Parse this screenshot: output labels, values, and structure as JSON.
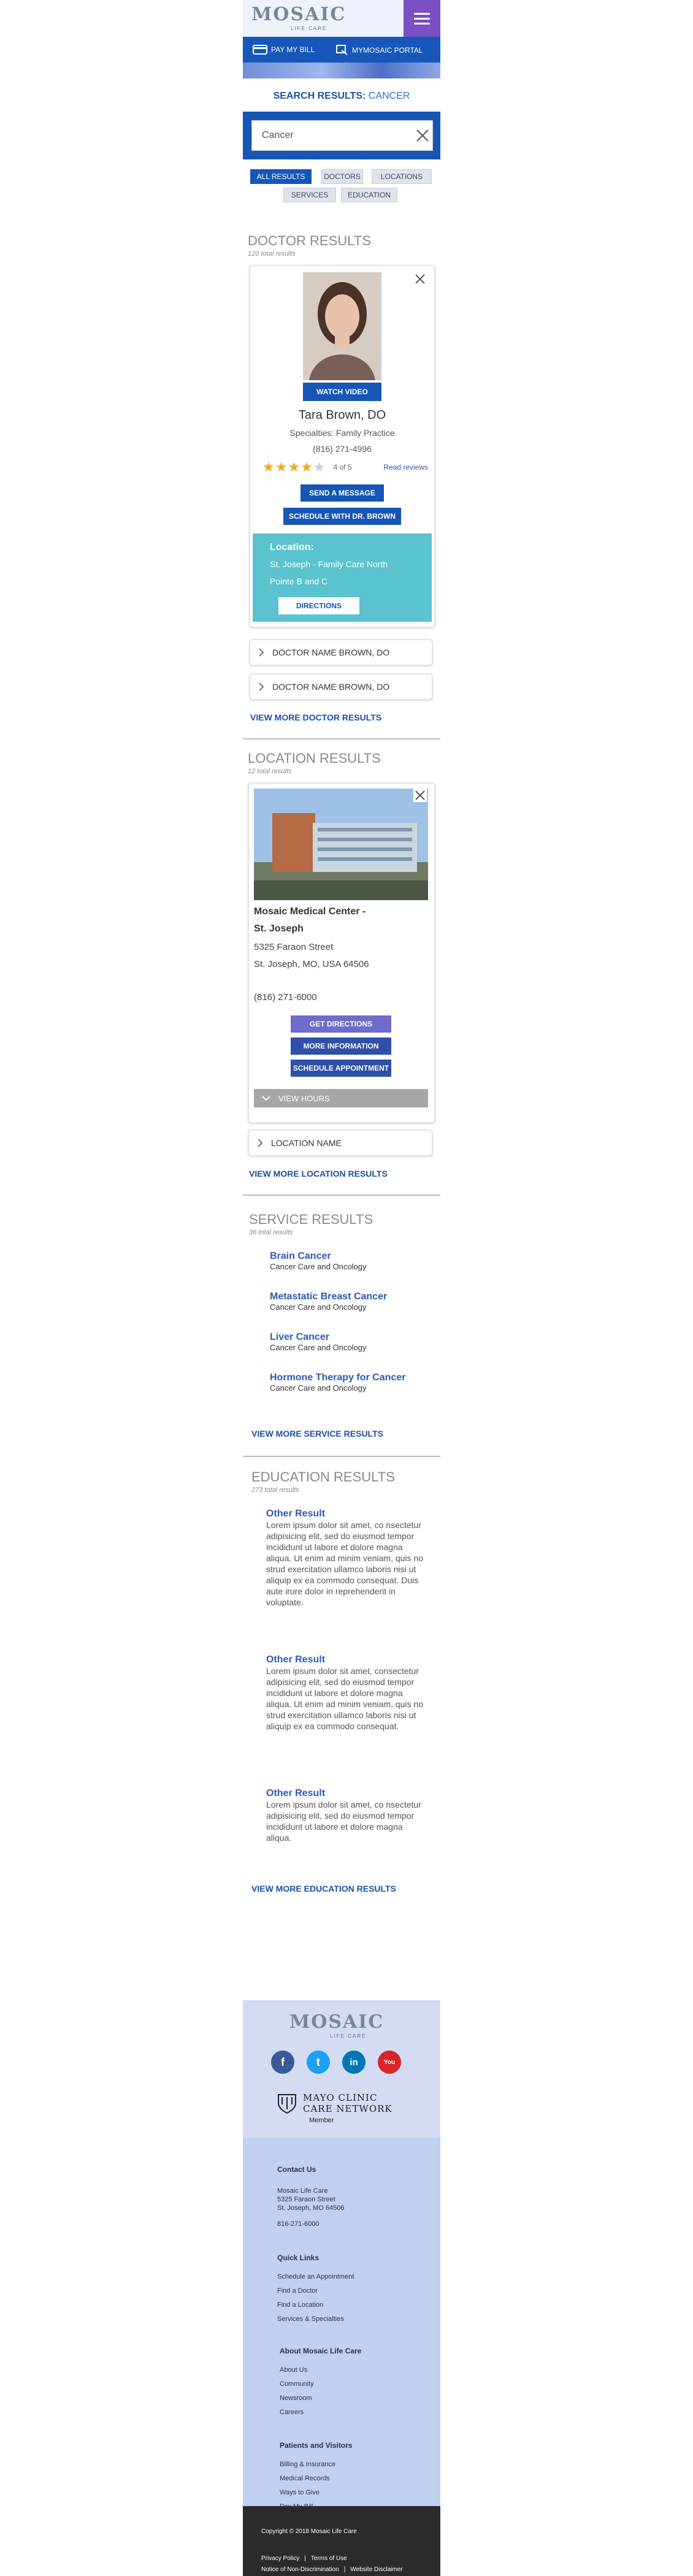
{
  "header": {
    "logo": "MOSAIC",
    "logo_sub": "LIFE CARE",
    "menu_icon": "hamburger-icon"
  },
  "topbar": {
    "pay_bill": "PAY MY BILL",
    "portal": "MYMOSAIC PORTAL"
  },
  "search": {
    "label": "SEARCH RESULTS:",
    "term": "CANCER",
    "value": "Cancer"
  },
  "filters": [
    "ALL RESULTS",
    "DOCTORS",
    "LOCATIONS",
    "SERVICES",
    "EDUCATION"
  ],
  "doctors": {
    "title": "DOCTOR RESULTS",
    "count": "120 total results",
    "featured": {
      "watch_video": "WATCH VIDEO",
      "name": "Tara Brown, DO",
      "specialty": "Specialties: Family Practice",
      "phone": "(816) 271-4996",
      "rating": "4 of 5",
      "rating_value": 4,
      "read_reviews": "Read reviews",
      "send_message": "SEND A MESSAGE",
      "schedule": "SCHEDULE WITH DR. BROWN",
      "location_label": "Location:",
      "location_line1": "St. Joseph - Family Care North",
      "location_line2": "Pointe B and C",
      "directions": "DIRECTIONS"
    },
    "collapsed": [
      "DOCTOR NAME BROWN, DO",
      "DOCTOR NAME BROWN, DO"
    ],
    "view_more": "VIEW MORE DOCTOR RESULTS"
  },
  "locations": {
    "title": "LOCATION RESULTS",
    "count": "12 total results",
    "featured": {
      "name_line1": "Mosaic Medical Center -",
      "name_line2": "St. Joseph",
      "address1": "5325 Faraon Street",
      "address2": "St. Joseph, MO, USA 64506",
      "phone": "(816) 271-6000",
      "get_directions": "GET DIRECTIONS",
      "more_info": "MORE INFORMATION",
      "schedule": "SCHEDULE APPOINTMENT",
      "view_hours": "VIEW HOURS"
    },
    "collapsed": [
      "LOCATION NAME"
    ],
    "view_more": "VIEW MORE LOCATION RESULTS"
  },
  "services": {
    "title": "SERVICE RESULTS",
    "count": "36 total results",
    "items": [
      {
        "name": "Brain Cancer",
        "desc": "Cancer Care and Oncology"
      },
      {
        "name": "Metastatic Breast Cancer",
        "desc": "Cancer Care and Oncology"
      },
      {
        "name": "Liver Cancer",
        "desc": "Cancer Care and Oncology"
      },
      {
        "name": "Hormone Therapy for Cancer",
        "desc": "Cancer Care and Oncology"
      }
    ],
    "view_more": "VIEW MORE SERVICE RESULTS"
  },
  "education": {
    "title": "EDUCATION RESULTS",
    "count": "273 total results",
    "items": [
      {
        "title": "Other Result",
        "text": "Lorem ipsum dolor sit amet, co nsectetur adipisicing elit, sed do eiusmod tempor incididunt ut labore et dolore magna aliqua. Ut enim ad minim veniam, quis no strud exercitation ullamco laboris nisi ut aliquip ex ea commodo consequat. Duis aute irure dolor in reprehenderit in voluptate."
      },
      {
        "title": "Other Result",
        "text": "Lorem ipsum dolor sit amet, consectetur adipisicing elit, sed do eiusmod tempor incididunt ut labore et dolore magna aliqua. Ut enim ad minim veniam, quis no strud exercitation ullamco laboris nisi ut aliquip ex ea commodo consequat."
      },
      {
        "title": "Other Result",
        "text": "Lorem ipsum dolor sit amet, co nsectetur adipisicing elit, sed do eiusmod tempor incididunt ut labore et dolore magna aliqua."
      }
    ],
    "view_more": "VIEW MORE EDUCATION RESULTS"
  },
  "footer": {
    "logo": "MOSAIC",
    "logo_sub": "LIFE CARE",
    "social": [
      {
        "icon": "facebook-icon",
        "glyph": "f",
        "color": "#3b5998"
      },
      {
        "icon": "twitter-icon",
        "glyph": "t",
        "color": "#1da1f2"
      },
      {
        "icon": "linkedin-icon",
        "glyph": "in",
        "color": "#0077b5"
      },
      {
        "icon": "youtube-icon",
        "glyph": "You",
        "color": "#d9252a"
      }
    ],
    "network_line1": "MAYO CLINIC",
    "network_line2": "CARE NETWORK",
    "network_member": "Member",
    "contact_title": "Contact Us",
    "contact_lines": [
      "Mosaic Life Care",
      "5325 Faraon Street",
      "St. Joseph, MO 64506"
    ],
    "contact_phone": "816-271-6000",
    "quick_title": "Quick Links",
    "quick_links": [
      "Schedule an Appointment",
      "Find a Doctor",
      "Find a Location",
      "Services & Specialties"
    ],
    "about_title": "About Mosaic Life Care",
    "about_links": [
      "About Us",
      "Community",
      "Newsroom",
      "Careers"
    ],
    "patients_title": "Patients and Visitors",
    "patients_links": [
      "Billing & Insurance",
      "Medical Records",
      "Ways to Give",
      "Pay My Bill"
    ],
    "copyright": "Copyright © 2018 Mosaic Life Care",
    "privacy": "Privacy Policy",
    "terms": "Terms of Use",
    "notice": "Notice of Non-Discrimination",
    "disclaimer": "Website Disclaimer",
    "sep": "|"
  },
  "colors": {
    "brand_blue": "#1556b7",
    "purple": "#7a4fc1",
    "teal": "#5ac3cd",
    "link": "#2f58b8"
  }
}
